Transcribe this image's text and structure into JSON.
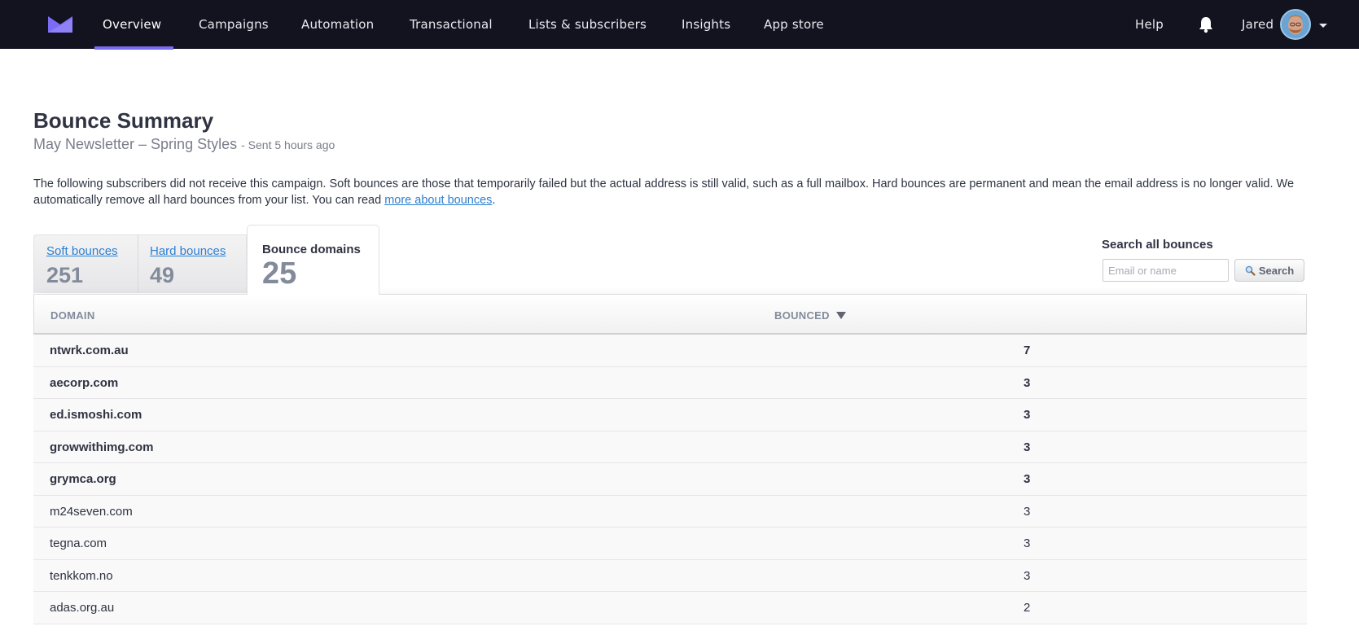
{
  "nav": {
    "items": [
      {
        "label": "Overview",
        "active": true
      },
      {
        "label": "Campaigns",
        "active": false
      },
      {
        "label": "Automation",
        "active": false
      },
      {
        "label": "Transactional",
        "active": false
      },
      {
        "label": "Lists & subscribers",
        "active": false
      },
      {
        "label": "Insights",
        "active": false
      },
      {
        "label": "App store",
        "active": false
      }
    ],
    "help_label": "Help",
    "user_name": "Jared",
    "accent_color": "#7b6cf6",
    "bg_color": "#13121f"
  },
  "header": {
    "title": "Bounce Summary",
    "campaign_name": "May Newsletter – Spring Styles",
    "sent_info": "- Sent 5 hours ago",
    "description_text": "The following subscribers did not receive this campaign. Soft bounces are those that temporarily failed but the actual address is still valid, such as a full mailbox. Hard bounces are permanent and mean the email address is no longer valid. We automatically remove all hard bounces from your list. You can read ",
    "description_link": "more about bounces",
    "description_end": "."
  },
  "tabs": [
    {
      "label": "Soft bounces",
      "count": "251",
      "active": false
    },
    {
      "label": "Hard bounces",
      "count": "49",
      "active": false
    },
    {
      "label": "Bounce domains",
      "count": "25",
      "active": true
    }
  ],
  "search": {
    "label": "Search all bounces",
    "placeholder": "Email or name",
    "value": "",
    "button_label": "Search"
  },
  "table": {
    "columns": [
      "DOMAIN",
      "BOUNCED"
    ],
    "sort_column": "BOUNCED",
    "sort_direction": "desc",
    "rows": [
      {
        "domain": "ntwrk.com.au",
        "bounced": "7",
        "bold": true
      },
      {
        "domain": "aecorp.com",
        "bounced": "3",
        "bold": true
      },
      {
        "domain": "ed.ismoshi.com",
        "bounced": "3",
        "bold": true
      },
      {
        "domain": "growwithimg.com",
        "bounced": "3",
        "bold": true
      },
      {
        "domain": "grymca.org",
        "bounced": "3",
        "bold": true
      },
      {
        "domain": "m24seven.com",
        "bounced": "3",
        "bold": false
      },
      {
        "domain": "tegna.com",
        "bounced": "3",
        "bold": false
      },
      {
        "domain": "tenkkom.no",
        "bounced": "3",
        "bold": false
      },
      {
        "domain": "adas.org.au",
        "bounced": "2",
        "bold": false
      }
    ]
  }
}
